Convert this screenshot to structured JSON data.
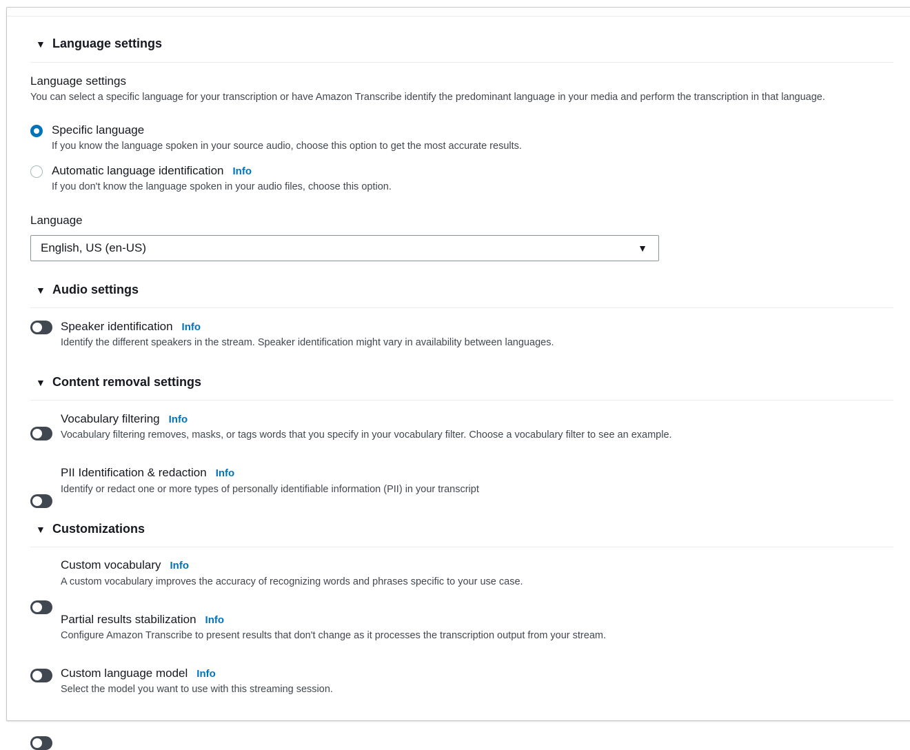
{
  "sections": {
    "language": "Language settings",
    "audio": "Audio settings",
    "content_removal": "Content removal settings",
    "customizations": "Customizations"
  },
  "info_label": "Info",
  "language_settings": {
    "heading": "Language settings",
    "description": "You can select a specific language for your transcription or have Amazon Transcribe identify the predominant language in your media and perform the transcription in that language.",
    "options": [
      {
        "label": "Specific language",
        "description": "If you know the language spoken in your source audio, choose this option to get the most accurate results.",
        "checked": true
      },
      {
        "label": "Automatic language identification",
        "description": "If you don't know the language spoken in your audio files, choose this option.",
        "checked": false
      }
    ]
  },
  "language": {
    "label": "Language",
    "selected": "English, US (en-US)"
  },
  "toggles": {
    "speaker_identification": {
      "label": "Speaker identification",
      "description": "Identify the different speakers in the stream. Speaker identification might vary in availability between languages.",
      "on": false
    },
    "vocabulary_filtering": {
      "label": "Vocabulary filtering",
      "description": "Vocabulary filtering removes, masks, or tags words that you specify in your vocabulary filter. Choose a vocabulary filter to see an example.",
      "on": false
    },
    "pii": {
      "label": "PII Identification & redaction",
      "description": "Identify or redact one or more types of personally identifiable information (PII) in your transcript",
      "on": false
    },
    "custom_vocabulary": {
      "label": "Custom vocabulary",
      "description": "A custom vocabulary improves the accuracy of recognizing words and phrases specific to your use case.",
      "on": false
    },
    "partial_results": {
      "label": "Partial results stabilization",
      "description": "Configure Amazon Transcribe to present results that don't change as it processes the transcription output from your stream.",
      "on": false
    },
    "custom_language_model": {
      "label": "Custom language model",
      "description": "Select the model you want to use with this streaming session.",
      "on": false
    }
  },
  "colors": {
    "link": "#0073bb",
    "toggle_off": "#414750",
    "text": "#16191f"
  }
}
